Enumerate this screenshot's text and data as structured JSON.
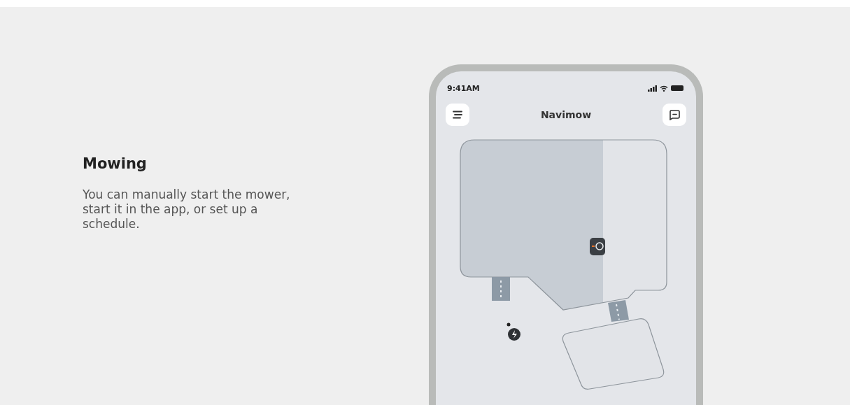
{
  "feature": {
    "title": "Mowing",
    "description": "You can manually start the mower, start it in the app, or set up a schedule."
  },
  "phone": {
    "status_bar": {
      "time": "9:41AM"
    },
    "app_bar": {
      "title": "Navimow"
    }
  }
}
